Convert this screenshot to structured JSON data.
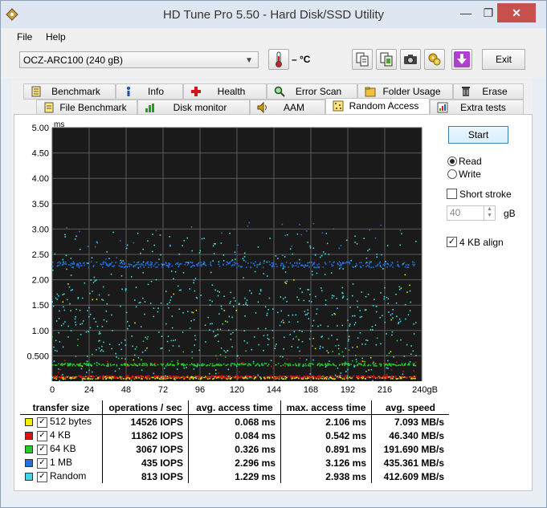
{
  "window": {
    "title": "HD Tune Pro 5.50 - Hard Disk/SSD Utility",
    "close_glyph": "✕",
    "min_glyph": "—",
    "max_glyph": "❐"
  },
  "menu": [
    "File",
    "Help"
  ],
  "toolbar": {
    "drive": "OCZ-ARC100 (240 gB)",
    "temperature": "– °C",
    "exit_label": "Exit"
  },
  "tabs_row1": [
    {
      "label": "Benchmark",
      "icon": "benchmark-icon"
    },
    {
      "label": "Info",
      "icon": "info-icon"
    },
    {
      "label": "Health",
      "icon": "health-icon"
    },
    {
      "label": "Error Scan",
      "icon": "magnifier-icon"
    },
    {
      "label": "Folder Usage",
      "icon": "folder-icon"
    },
    {
      "label": "Erase",
      "icon": "trash-icon"
    }
  ],
  "tabs_row2": [
    {
      "label": "File Benchmark",
      "icon": "file-icon"
    },
    {
      "label": "Disk monitor",
      "icon": "monitor-icon"
    },
    {
      "label": "AAM",
      "icon": "speaker-icon"
    },
    {
      "label": "Random Access",
      "icon": "random-access-icon",
      "active": true
    },
    {
      "label": "Extra tests",
      "icon": "extra-tests-icon"
    }
  ],
  "controls": {
    "start_label": "Start",
    "read_label": "Read",
    "write_label": "Write",
    "mode": "read",
    "short_stroke_label": "Short stroke",
    "short_stroke_checked": false,
    "stroke_value": "40",
    "stroke_unit": "gB",
    "align_label": "4 KB align",
    "align_checked": true
  },
  "chart_data": {
    "type": "scatter",
    "y_unit": "ms",
    "x_unit": "gB",
    "ylim": [
      0,
      5.0
    ],
    "xlim": [
      0,
      240
    ],
    "y_ticks": [
      "5.00",
      "4.50",
      "4.00",
      "3.50",
      "3.00",
      "2.50",
      "2.00",
      "1.50",
      "1.00",
      "0.500"
    ],
    "x_ticks": [
      "0",
      "24",
      "48",
      "72",
      "96",
      "120",
      "144",
      "168",
      "192",
      "216",
      "240gB"
    ],
    "grid": true,
    "series": [
      {
        "name": "512 bytes",
        "color": "#e8e800",
        "avg_ms": 0.068,
        "max_ms": 2.106
      },
      {
        "name": "4 KB",
        "color": "#e01010",
        "avg_ms": 0.084,
        "max_ms": 0.542
      },
      {
        "name": "64 KB",
        "color": "#20d020",
        "avg_ms": 0.326,
        "max_ms": 0.891
      },
      {
        "name": "1 MB",
        "color": "#2070e0",
        "avg_ms": 2.296,
        "max_ms": 3.126
      },
      {
        "name": "Random",
        "color": "#40d8e0",
        "avg_ms": 1.229,
        "max_ms": 2.938
      }
    ]
  },
  "results": {
    "headers": [
      "transfer size",
      "operations / sec",
      "avg. access time",
      "max. access time",
      "avg. speed"
    ],
    "rows": [
      {
        "size": "512 bytes",
        "color": "#f0f000",
        "ops": "14526 IOPS",
        "avg": "0.068 ms",
        "max": "2.106 ms",
        "speed": "7.093 MB/s"
      },
      {
        "size": "4 KB",
        "color": "#e01010",
        "ops": "11862 IOPS",
        "avg": "0.084 ms",
        "max": "0.542 ms",
        "speed": "46.340 MB/s"
      },
      {
        "size": "64 KB",
        "color": "#20d020",
        "ops": "3067 IOPS",
        "avg": "0.326 ms",
        "max": "0.891 ms",
        "speed": "191.690 MB/s"
      },
      {
        "size": "1 MB",
        "color": "#2070e0",
        "ops": "435 IOPS",
        "avg": "2.296 ms",
        "max": "3.126 ms",
        "speed": "435.361 MB/s"
      },
      {
        "size": "Random",
        "color": "#40d8e0",
        "ops": "813 IOPS",
        "avg": "1.229 ms",
        "max": "2.938 ms",
        "speed": "412.609 MB/s"
      }
    ]
  }
}
